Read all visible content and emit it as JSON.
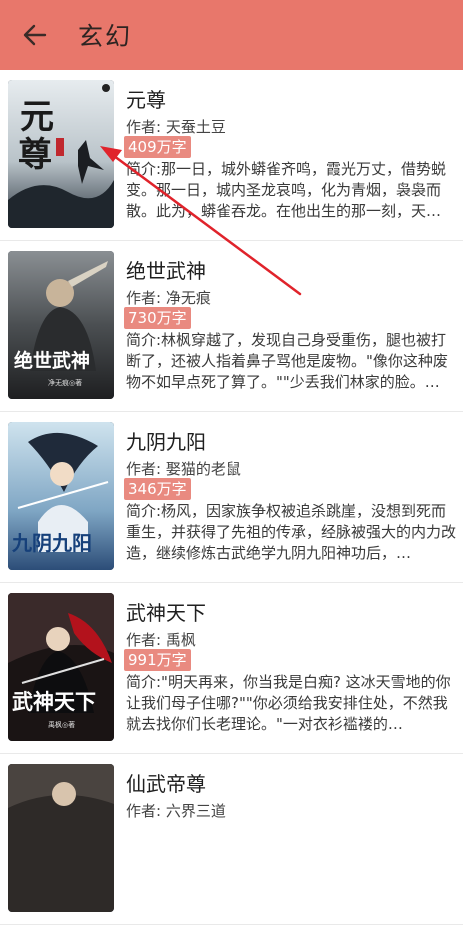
{
  "header": {
    "title": "玄幻",
    "back_icon": "back-arrow-icon",
    "bg_color": "#e8776b"
  },
  "books": [
    {
      "title": "元尊",
      "author": "作者: 天蚕土豆",
      "words": "409万字",
      "desc": "简介:那一日，城外蟒雀齐鸣，霞光万丈，借势蜕变。那一日，城内圣龙哀鸣，化为青烟，袅袅而散。此为，蟒雀吞龙。在他出生的那一刻，天…",
      "cover_text": "元尊"
    },
    {
      "title": "绝世武神",
      "author": "作者: 净无痕",
      "words": "730万字",
      "desc": "简介:林枫穿越了，发现自己身受重伤，腿也被打断了，还被人指着鼻子骂他是废物。\"像你这种废物不如早点死了算了。\"\"少丢我们林家的脸。…",
      "cover_text": "绝世武神"
    },
    {
      "title": "九阴九阳",
      "author": "作者: 娶猫的老鼠",
      "words": "346万字",
      "desc": "简介:杨风，因家族争权被追杀跳崖，没想到死而重生，并获得了先祖的传承，经脉被强大的内力改造，继续修炼古武绝学九阴九阳神功后，…",
      "cover_text": "九阴九阳"
    },
    {
      "title": "武神天下",
      "author": "作者: 禹枫",
      "words": "991万字",
      "desc": "简介:\"明天再来，你当我是白痴? 这冰天雪地的你让我们母子住哪?\"\"你必须给我安排住处，不然我就去找你们长老理论。\"一对衣衫褴褛的…",
      "cover_text": "武神天下"
    },
    {
      "title": "仙武帝尊",
      "author": "作者: 六界三道",
      "words": "",
      "desc": "",
      "cover_text": ""
    }
  ],
  "colors": {
    "accent": "#e8776b",
    "word_badge": "#e98a80",
    "annotation_arrow": "#e0232b"
  }
}
